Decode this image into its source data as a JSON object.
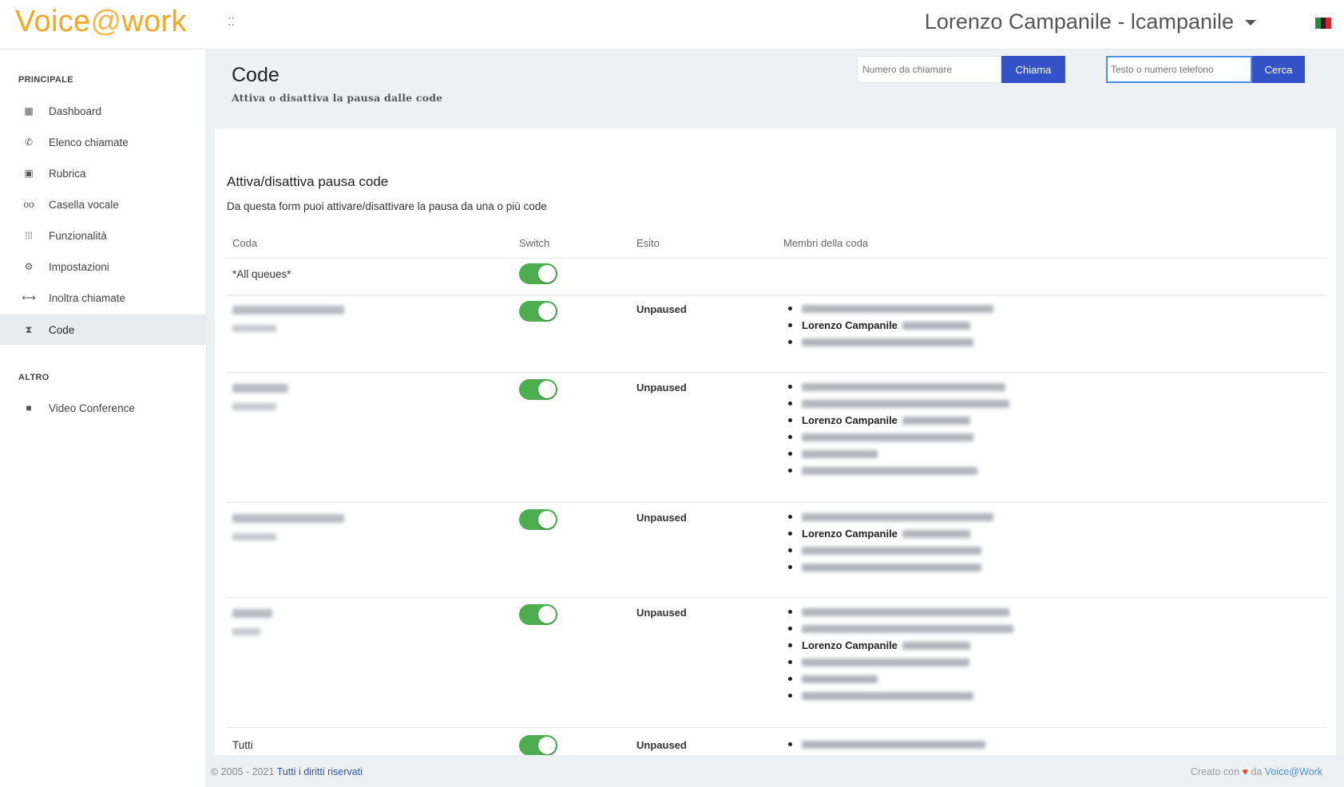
{
  "header": {
    "logo_prefix": "Voice",
    "logo_at": "@",
    "logo_suffix": "work",
    "menu_toggle": "⁚⁚",
    "user": "Lorenzo Campanile - lcampanile",
    "flag_colors": [
      "#1e8f3e",
      "#222222",
      "#e0202a"
    ]
  },
  "sidebar": {
    "section_main": "PRINCIPALE",
    "section_other": "ALTRO",
    "items": [
      {
        "label": "Dashboard",
        "icon": "dashboard-icon",
        "glyph": "▦"
      },
      {
        "label": "Elenco chiamate",
        "icon": "phone-icon",
        "glyph": "✆"
      },
      {
        "label": "Rubrica",
        "icon": "address-book-icon",
        "glyph": "▣"
      },
      {
        "label": "Casella vocale",
        "icon": "voicemail-icon",
        "glyph": "oo"
      },
      {
        "label": "Funzionalità",
        "icon": "grid-icon",
        "glyph": "⁞⁞⁞"
      },
      {
        "label": "Impostazioni",
        "icon": "gear-icon",
        "glyph": "⚙"
      },
      {
        "label": "Inoltra chiamate",
        "icon": "forward-icon",
        "glyph": "⟷"
      },
      {
        "label": "Code",
        "icon": "hourglass-icon",
        "glyph": "⧗"
      }
    ],
    "other_items": [
      {
        "label": "Video Conference",
        "icon": "video-icon",
        "glyph": "■"
      }
    ]
  },
  "page": {
    "title": "Code",
    "subtitle": "Attiva o disattiva la pausa dalle code"
  },
  "toolbar": {
    "dial_placeholder": "Numero da chiamare",
    "dial_button": "Chiama",
    "search_placeholder": "Testo o numero telefono",
    "search_button": "Cerca"
  },
  "card": {
    "title": "Attiva/disattiva pausa code",
    "description": "Da questa form puoi attivare/disattivare la pausa da una o più code"
  },
  "table": {
    "columns": [
      "Coda",
      "Switch",
      "Esito",
      "Membri della coda"
    ],
    "all_queues_label": "*All queues*",
    "member_name": "Lorenzo Campanile",
    "status_label": "Unpaused",
    "last_queue_label": "Tutti"
  },
  "footer": {
    "copyright": "© 2005 - 2021 ",
    "rights_link": "Tutti i diritti riservati",
    "created_with": "Creato con ",
    "heart": "♥",
    "by": " da ",
    "brand_link": "Voice@Work"
  }
}
